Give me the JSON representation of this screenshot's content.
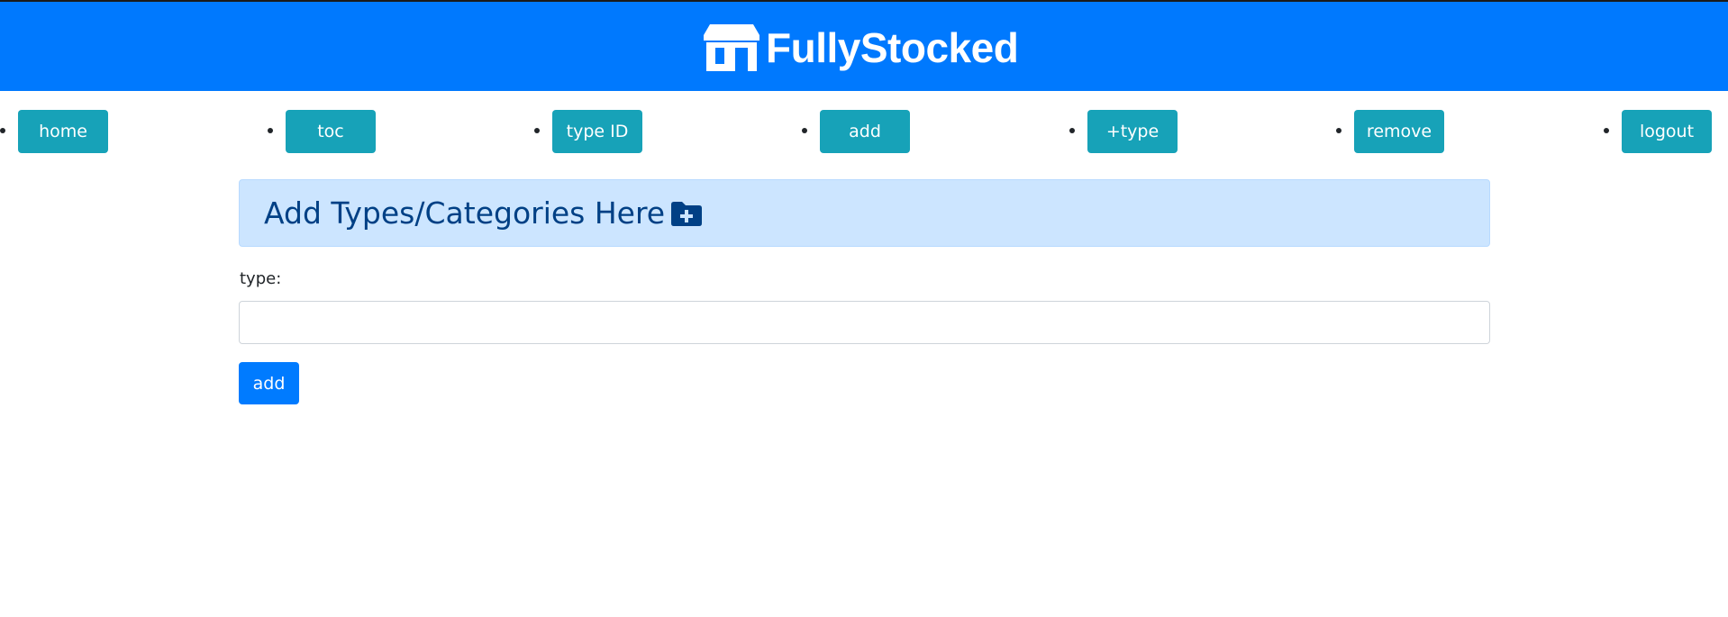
{
  "header": {
    "brand_name": "FullyStocked",
    "brand_icon": "store-icon",
    "background_color": "#0079fe"
  },
  "nav": {
    "button_color": "#17a2b8",
    "items": [
      {
        "label": "home"
      },
      {
        "label": "toc"
      },
      {
        "label": "type ID"
      },
      {
        "label": "add"
      },
      {
        "label": "+type"
      },
      {
        "label": "remove"
      },
      {
        "label": "logout"
      }
    ]
  },
  "alert": {
    "title": "Add Types/Categories Here",
    "icon": "folder-plus-icon",
    "background_color": "#cce5ff",
    "text_color": "#004085"
  },
  "form": {
    "type_label": "type:",
    "type_value": "",
    "submit_label": "add",
    "submit_color": "#007bff"
  }
}
